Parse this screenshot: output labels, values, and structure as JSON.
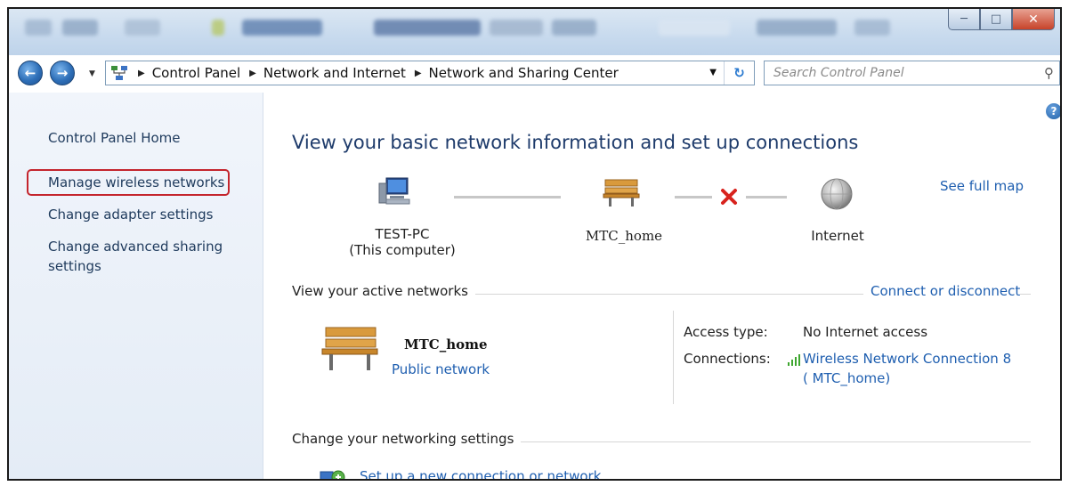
{
  "window": {
    "minimize_glyph": "─",
    "maximize_glyph": "□",
    "close_glyph": "✕"
  },
  "nav": {
    "back_glyph": "←",
    "forward_glyph": "→",
    "breadcrumb": [
      "Control Panel",
      "Network and Internet",
      "Network and Sharing Center"
    ],
    "refresh_glyph": "↻",
    "search_placeholder": "Search Control Panel"
  },
  "sidebar": {
    "items": [
      {
        "label": "Control Panel Home"
      },
      {
        "label": "Manage wireless networks",
        "highlighted": true
      },
      {
        "label": "Change adapter settings"
      },
      {
        "label": "Change advanced sharing settings",
        "line1": "Change advanced sharing",
        "line2": "settings"
      }
    ]
  },
  "main": {
    "help_glyph": "?",
    "title": "View your basic network information and set up connections",
    "see_full_map": "See full map",
    "map": {
      "computer": {
        "name": "TEST-PC",
        "sub": "(This computer)",
        "icon": "computer-icon"
      },
      "network": {
        "name": "MTC_home",
        "icon": "bench-icon"
      },
      "internet": {
        "name": "Internet",
        "icon": "globe-icon"
      },
      "link_status": "disconnected"
    },
    "active_networks": {
      "label": "View your active networks",
      "action": "Connect or disconnect",
      "network_name": "MTC_home",
      "network_type": "Public network",
      "access_type_key": "Access type:",
      "access_type_value": "No Internet access",
      "connections_key": "Connections:",
      "connection_line1": "Wireless Network Connection 8",
      "connection_line2": "( MTC_home)"
    },
    "change_settings": {
      "label": "Change your networking settings",
      "items": [
        {
          "label": "Set up a new connection or network",
          "icon": "setup-connection-icon"
        }
      ]
    }
  },
  "colors": {
    "link": "#1f5fb0",
    "title": "#1e3b6b",
    "highlight_border": "#c4252d",
    "error_x": "#d8231e"
  }
}
